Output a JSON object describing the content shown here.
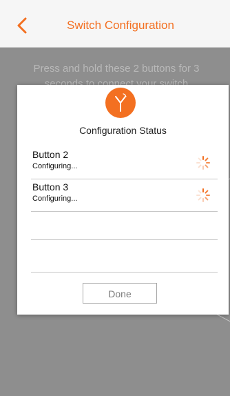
{
  "header": {
    "title": "Switch Configuration",
    "back_icon": "chevron-left-icon",
    "accent_color": "#f37021"
  },
  "background": {
    "instruction": "Press and hold these 2 buttons for 3 seconds to connect your switch"
  },
  "modal": {
    "icon": "switch-signal-icon",
    "title": "Configuration Status",
    "rows": [
      {
        "name": "Button 2",
        "status": "Configuring...",
        "indicator": "spinner-icon"
      },
      {
        "name": "Button 3",
        "status": "Configuring...",
        "indicator": "spinner-icon"
      }
    ],
    "done_label": "Done"
  }
}
